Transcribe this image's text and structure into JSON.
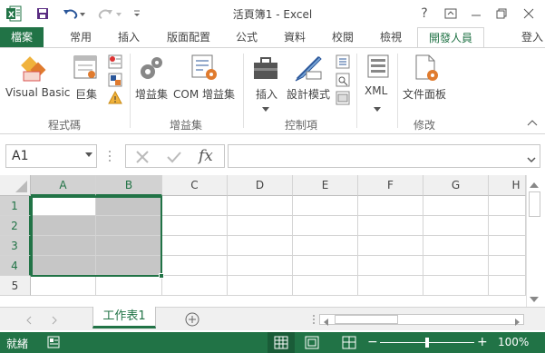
{
  "window": {
    "title": "活頁簿1 - Excel",
    "help_label": "?",
    "signin_label": "登入"
  },
  "tabs": [
    "檔案",
    "常用",
    "插入",
    "版面配置",
    "公式",
    "資料",
    "校閱",
    "檢視",
    "開發人員"
  ],
  "ribbon": {
    "visual_basic_label": "Visual Basic",
    "macros_label": "巨集",
    "addins_label": "增益集",
    "com_addins_label": "COM 增益集",
    "insert_label": "插入",
    "design_mode_label": "設計模式",
    "xml_label": "XML",
    "doc_panel_label": "文件面板",
    "groups": [
      "程式碼",
      "增益集",
      "控制項",
      "修改"
    ]
  },
  "formula_bar": {
    "name_box": "A1",
    "fx_label": "fx",
    "formula": ""
  },
  "grid": {
    "columns": [
      "A",
      "B",
      "C",
      "D",
      "E",
      "F",
      "G",
      "H"
    ],
    "rows": [
      "1",
      "2",
      "3",
      "4",
      "5"
    ]
  },
  "sheet_tabs": [
    "工作表1"
  ],
  "status": {
    "ready": "就緒",
    "zoom": "100%"
  },
  "colors": {
    "accent": "#217346",
    "selection_fill": "#c6c6c6"
  }
}
